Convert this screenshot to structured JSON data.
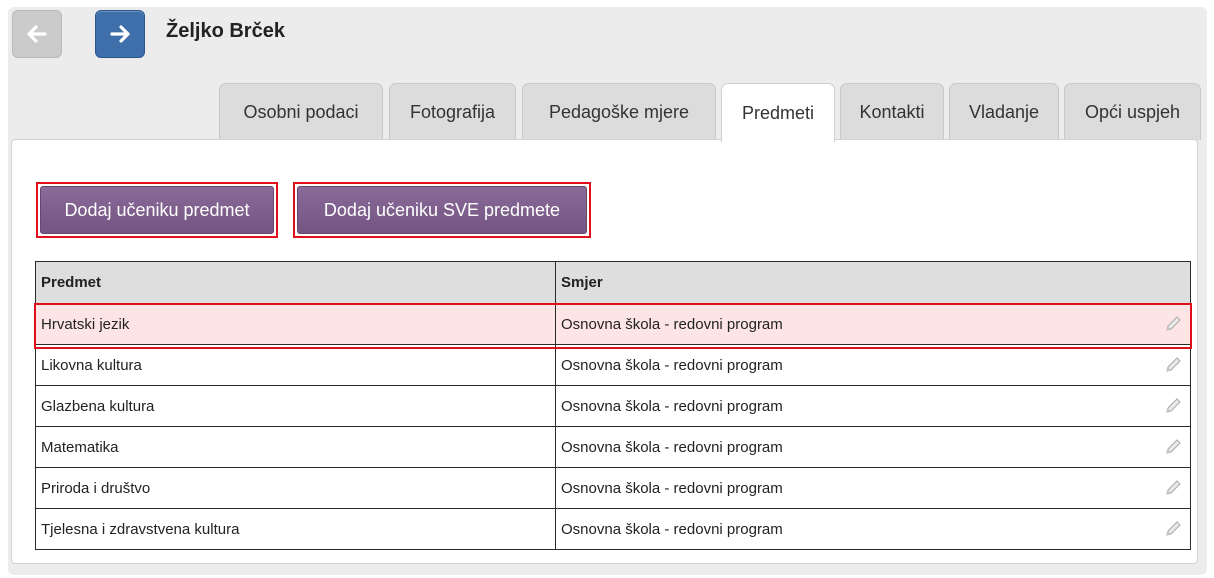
{
  "header": {
    "title": "Željko Brček",
    "back_icon": "arrow-left-icon",
    "forward_icon": "arrow-right-icon"
  },
  "tabs": [
    {
      "label": "Osobni podaci",
      "active": false
    },
    {
      "label": "Fotografija",
      "active": false
    },
    {
      "label": "Pedagoške mjere",
      "active": false
    },
    {
      "label": "Predmeti",
      "active": true
    },
    {
      "label": "Kontakti",
      "active": false
    },
    {
      "label": "Vladanje",
      "active": false
    },
    {
      "label": "Opći uspjeh",
      "active": false
    }
  ],
  "actions": {
    "add_subject": "Dodaj učeniku predmet",
    "add_all_subjects": "Dodaj učeniku SVE predmete"
  },
  "table": {
    "headers": [
      "Predmet",
      "Smjer"
    ],
    "rows": [
      {
        "subject": "Hrvatski jezik",
        "direction": "Osnovna škola - redovni program",
        "highlighted": true
      },
      {
        "subject": "Likovna kultura",
        "direction": "Osnovna škola - redovni program",
        "highlighted": false
      },
      {
        "subject": "Glazbena kultura",
        "direction": "Osnovna škola - redovni program",
        "highlighted": false
      },
      {
        "subject": "Matematika",
        "direction": "Osnovna škola - redovni program",
        "highlighted": false
      },
      {
        "subject": "Priroda i društvo",
        "direction": "Osnovna škola - redovni program",
        "highlighted": false
      },
      {
        "subject": "Tjelesna i zdravstvena kultura",
        "direction": "Osnovna škola - redovni program",
        "highlighted": false
      }
    ],
    "edit_icon": "pencil-icon"
  },
  "colors": {
    "accent": "#3f6faa",
    "action_button": "#7a5a88",
    "highlight_outline": "#e0101b",
    "highlight_row": "#fde4e5"
  }
}
